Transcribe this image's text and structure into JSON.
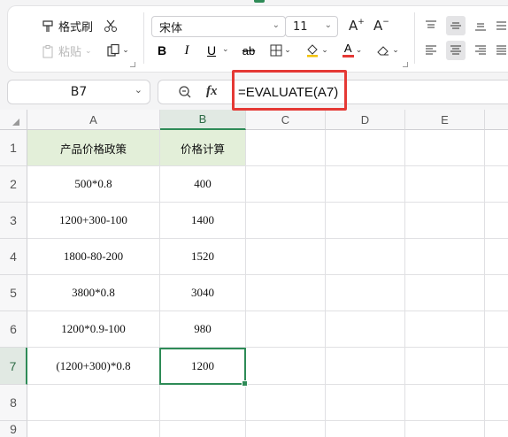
{
  "ribbon": {
    "format_painter": "格式刷",
    "paste": "粘贴",
    "font_name": "宋体",
    "font_size": "11",
    "bold": "B",
    "italic": "I",
    "underline": "U",
    "strike": "ab",
    "grow_font": "A",
    "shrink_font": "A",
    "font_color": "A"
  },
  "formula_bar": {
    "name_box": "B7",
    "fx": "fx",
    "formula": "=EVALUATE(A7)"
  },
  "sheet": {
    "columns": [
      "A",
      "B",
      "C",
      "D",
      "E"
    ],
    "rows": [
      "1",
      "2",
      "3",
      "4",
      "5",
      "6",
      "7",
      "8",
      "9"
    ],
    "headers": [
      "产品价格政策",
      "价格计算"
    ],
    "data": [
      [
        "500*0.8",
        "400"
      ],
      [
        "1200+300-100",
        "1400"
      ],
      [
        "1800-80-200",
        "1520"
      ],
      [
        "3800*0.8",
        "3040"
      ],
      [
        "1200*0.9-100",
        "980"
      ],
      [
        "(1200+300)*0.8",
        "1200"
      ]
    ]
  },
  "colors": {
    "accent": "#2e8b57",
    "header_fill": "#e3efd9",
    "highlight": "#e53935"
  }
}
